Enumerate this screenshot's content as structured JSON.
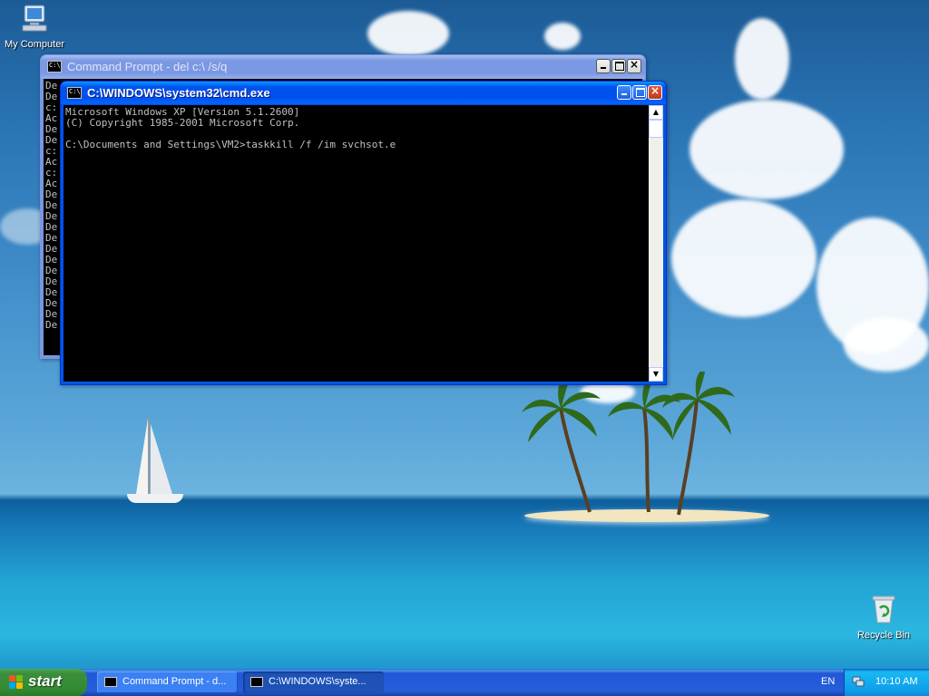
{
  "desktop": {
    "icons": [
      {
        "label": "My Computer",
        "icon": "my-computer-icon"
      },
      {
        "label": "Recycle Bin",
        "icon": "recycle-bin-icon"
      }
    ]
  },
  "windows": {
    "back": {
      "title": "Command Prompt - del c:\\ /s/q",
      "state": "inactive",
      "console_lines": [
        "De",
        "De",
        "c:",
        "Ac",
        "De",
        "De",
        "c:",
        "Ac",
        "c:",
        "Ac",
        "De",
        "De",
        "De",
        "De",
        "De",
        "De",
        "De",
        "De",
        "De",
        "De",
        "De",
        "De",
        "De"
      ]
    },
    "front": {
      "title": "C:\\WINDOWS\\system32\\cmd.exe",
      "state": "active",
      "console_lines": [
        "Microsoft Windows XP [Version 5.1.2600]",
        "(C) Copyright 1985-2001 Microsoft Corp.",
        "",
        "C:\\Documents and Settings\\VM2>taskkill /f /im svchsot.e"
      ]
    }
  },
  "taskbar": {
    "start_label": "start",
    "tasks": [
      {
        "label": "Command Prompt - d...",
        "active": false
      },
      {
        "label": "C:\\WINDOWS\\syste...",
        "active": true
      }
    ],
    "language": "EN",
    "clock": "10:10 AM"
  },
  "colors": {
    "titlebar_active": "#0053ee",
    "titlebar_inactive": "#7b98e3",
    "taskbar": "#245edb",
    "start_button": "#3c8f3c",
    "tray": "#0f9de9",
    "console_bg": "#000000",
    "console_fg": "#c0c0c0"
  }
}
